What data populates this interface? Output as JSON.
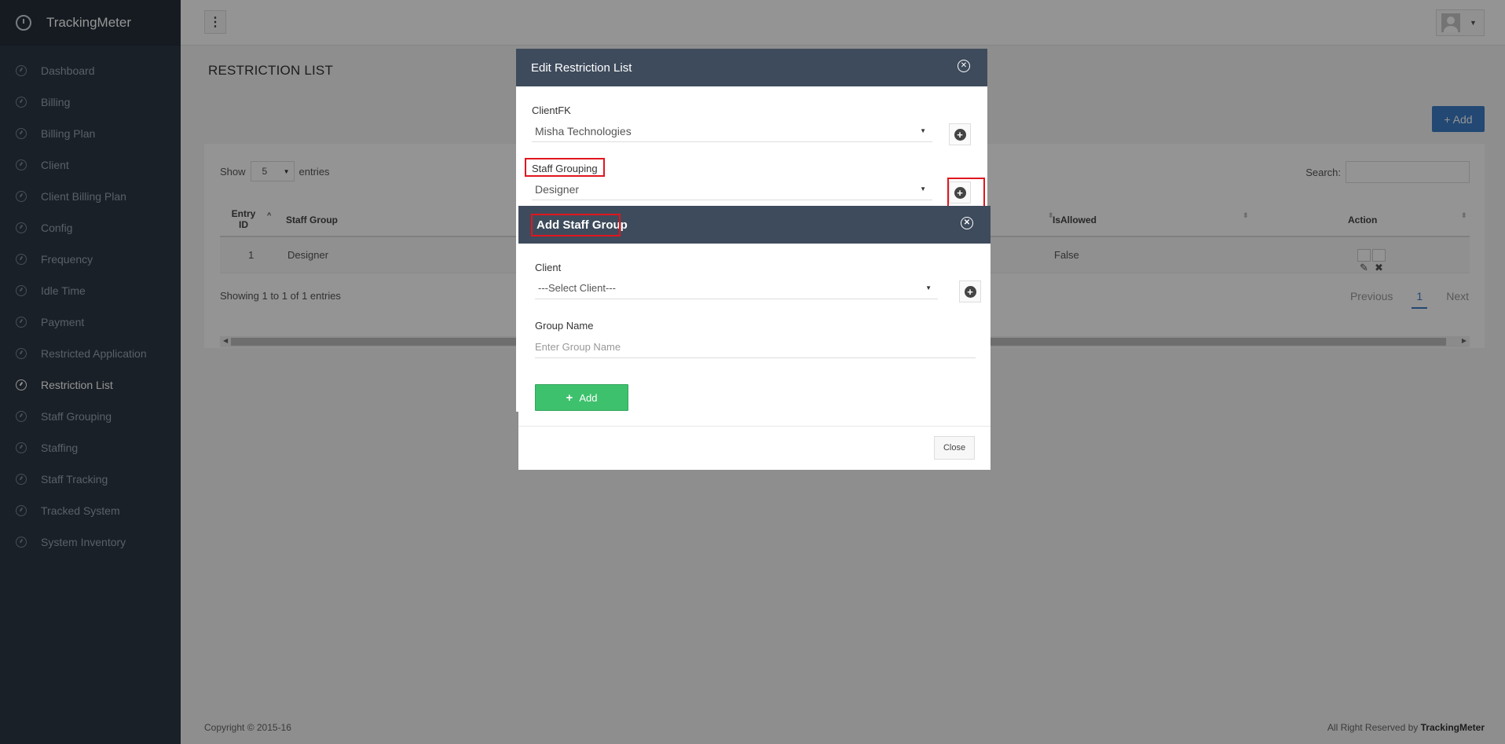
{
  "app": {
    "name": "TrackingMeter"
  },
  "sidebar": {
    "items": [
      {
        "label": "Dashboard"
      },
      {
        "label": "Billing"
      },
      {
        "label": "Billing Plan"
      },
      {
        "label": "Client"
      },
      {
        "label": "Client Billing Plan"
      },
      {
        "label": "Config"
      },
      {
        "label": "Frequency"
      },
      {
        "label": "Idle Time"
      },
      {
        "label": "Payment"
      },
      {
        "label": "Restricted Application"
      },
      {
        "label": "Restriction List"
      },
      {
        "label": "Staff Grouping"
      },
      {
        "label": "Staffing"
      },
      {
        "label": "Staff Tracking"
      },
      {
        "label": "Tracked System"
      },
      {
        "label": "System Inventory"
      }
    ],
    "active": "Restriction List"
  },
  "topbar": {
    "menu_icon": "⋮",
    "caret": "▼"
  },
  "page": {
    "title": "RESTRICTION LIST",
    "add_label": "+ Add"
  },
  "table": {
    "show_label": "Show",
    "show_value": "5",
    "entries_label": "entries",
    "search_label": "Search:",
    "columns": [
      "Entry ID",
      "Staff Group",
      "IsAllowed",
      "Action"
    ],
    "rows": [
      {
        "entry_id": "1",
        "staff_group": "Designer",
        "is_allowed": "False"
      }
    ],
    "info": "Showing 1 to 1 of 1 entries",
    "pager": {
      "previous": "Previous",
      "current": "1",
      "next": "Next"
    }
  },
  "footer": {
    "copyright": "Copyright © 2015-16",
    "rights_prefix": "All Right Reserved by ",
    "rights_brand": "TrackingMeter"
  },
  "edit_modal": {
    "title": "Edit Restriction List",
    "client_label": "ClientFK",
    "client_value": "Misha Technologies",
    "staff_grouping_label": "Staff Grouping",
    "staff_grouping_value": "Designer"
  },
  "add_modal": {
    "title": "Add Staff Group",
    "client_label": "Client",
    "client_value": "---Select Client---",
    "group_name_label": "Group Name",
    "group_name_placeholder": "Enter Group Name",
    "add_label": "Add",
    "close_label": "Close"
  },
  "colors": {
    "sidebar_bg": "#2c3744",
    "modal_header": "#3e4b5c",
    "primary": "#3b7dc7",
    "success": "#3dc16c",
    "highlight": "#e0161e"
  }
}
